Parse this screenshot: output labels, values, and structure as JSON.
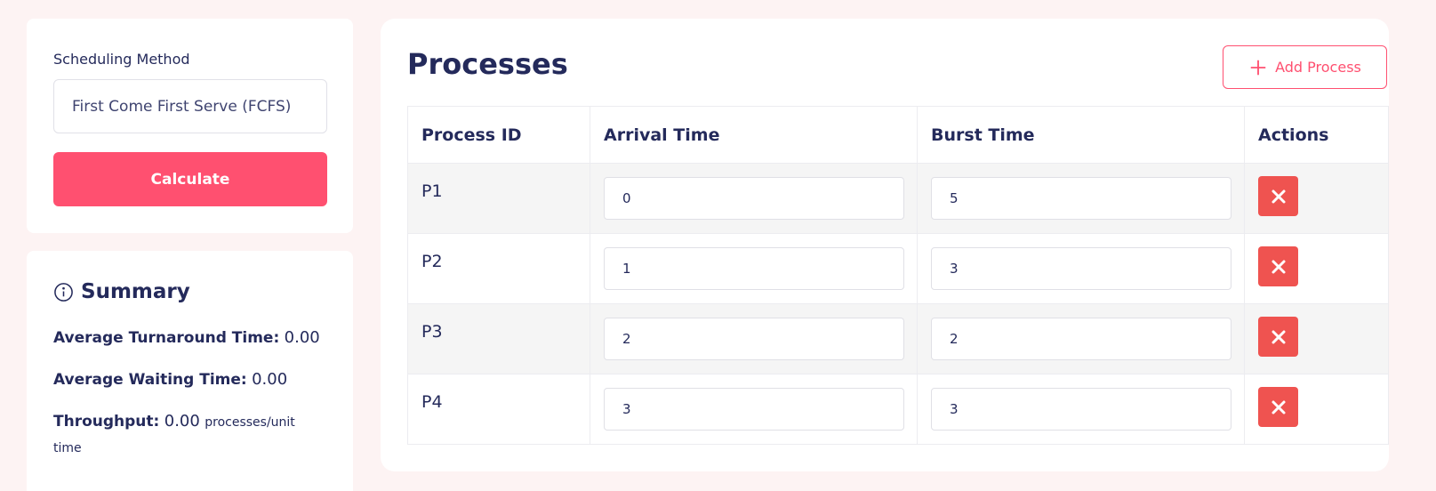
{
  "method": {
    "label": "Scheduling Method",
    "selected": "First Come First Serve (FCFS)",
    "calculate_label": "Calculate"
  },
  "summary": {
    "title": "Summary",
    "icon": "info-icon",
    "avg_turnaround_label": "Average Turnaround Time:",
    "avg_turnaround_value": "0.00",
    "avg_waiting_label": "Average Waiting Time:",
    "avg_waiting_value": "0.00",
    "throughput_label": "Throughput:",
    "throughput_value": "0.00",
    "throughput_unit": "processes/unit time"
  },
  "processes": {
    "title": "Processes",
    "add_label": "Add Process",
    "columns": [
      "Process ID",
      "Arrival Time",
      "Burst Time",
      "Actions"
    ],
    "rows": [
      {
        "id": "P1",
        "arrival": "0",
        "burst": "5"
      },
      {
        "id": "P2",
        "arrival": "1",
        "burst": "3"
      },
      {
        "id": "P3",
        "arrival": "2",
        "burst": "2"
      },
      {
        "id": "P4",
        "arrival": "3",
        "burst": "3"
      }
    ]
  },
  "colors": {
    "accent": "#ff5070",
    "delete": "#ef5350",
    "text": "#242a5b",
    "background": "#fdf3f3"
  }
}
